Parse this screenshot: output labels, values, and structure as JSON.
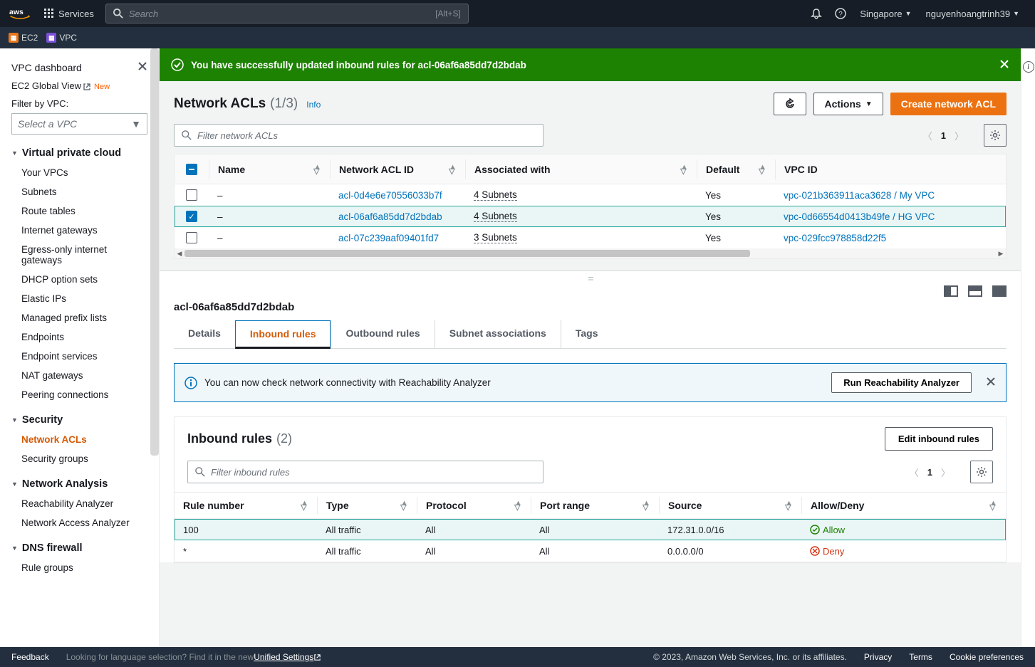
{
  "top_nav": {
    "services": "Services",
    "search_placeholder": "Search",
    "search_kbd": "[Alt+S]",
    "region": "Singapore",
    "account": "nguyenhoangtrinh39"
  },
  "sub_nav": {
    "ec2": "EC2",
    "vpc": "VPC"
  },
  "sidebar": {
    "dashboard": "VPC dashboard",
    "ec2_global": "EC2 Global View",
    "new_badge": "New",
    "filter_label": "Filter by VPC:",
    "filter_placeholder": "Select a VPC",
    "sections": {
      "vpc": {
        "title": "Virtual private cloud",
        "items": [
          "Your VPCs",
          "Subnets",
          "Route tables",
          "Internet gateways",
          "Egress-only internet gateways",
          "DHCP option sets",
          "Elastic IPs",
          "Managed prefix lists",
          "Endpoints",
          "Endpoint services",
          "NAT gateways",
          "Peering connections"
        ]
      },
      "security": {
        "title": "Security",
        "items": [
          "Network ACLs",
          "Security groups"
        ]
      },
      "na": {
        "title": "Network Analysis",
        "items": [
          "Reachability Analyzer",
          "Network Access Analyzer"
        ]
      },
      "dns": {
        "title": "DNS firewall",
        "items": [
          "Rule groups"
        ]
      }
    }
  },
  "banner": {
    "msg": "You have successfully updated inbound rules for acl-06af6a85dd7d2bdab"
  },
  "header": {
    "title": "Network ACLs",
    "count": "(1/3)",
    "info": "Info",
    "actions": "Actions",
    "create": "Create network ACL"
  },
  "filter": {
    "placeholder": "Filter network ACLs"
  },
  "pager": {
    "page": "1"
  },
  "table": {
    "cols": {
      "name": "Name",
      "id": "Network ACL ID",
      "assoc": "Associated with",
      "default": "Default",
      "vpc": "VPC ID"
    },
    "rows": [
      {
        "name": "–",
        "id": "acl-0d4e6e70556033b7f",
        "assoc": "4 Subnets",
        "default": "Yes",
        "vpc": "vpc-021b363911aca3628 / My VPC",
        "selected": false
      },
      {
        "name": "–",
        "id": "acl-06af6a85dd7d2bdab",
        "assoc": "4 Subnets",
        "default": "Yes",
        "vpc": "vpc-0d66554d0413b49fe / HG VPC",
        "selected": true
      },
      {
        "name": "–",
        "id": "acl-07c239aaf09401fd7",
        "assoc": "3 Subnets",
        "default": "Yes",
        "vpc": "vpc-029fcc978858d22f5",
        "selected": false
      }
    ]
  },
  "detail": {
    "title": "acl-06af6a85dd7d2bdab",
    "tabs": [
      "Details",
      "Inbound rules",
      "Outbound rules",
      "Subnet associations",
      "Tags"
    ],
    "info_msg": "You can now check network connectivity with Reachability Analyzer",
    "run_btn": "Run Reachability Analyzer",
    "panel": {
      "title": "Inbound rules",
      "count": "(2)",
      "edit_btn": "Edit inbound rules",
      "filter_placeholder": "Filter inbound rules",
      "page": "1",
      "cols": {
        "num": "Rule number",
        "type": "Type",
        "proto": "Protocol",
        "port": "Port range",
        "src": "Source",
        "ad": "Allow/Deny"
      },
      "rows": [
        {
          "num": "100",
          "type": "All traffic",
          "proto": "All",
          "port": "All",
          "src": "172.31.0.0/16",
          "ad": "Allow"
        },
        {
          "num": "*",
          "type": "All traffic",
          "proto": "All",
          "port": "All",
          "src": "0.0.0.0/0",
          "ad": "Deny"
        }
      ]
    }
  },
  "footer": {
    "feedback": "Feedback",
    "lang_q": "Looking for language selection? Find it in the new ",
    "lang_link": "Unified Settings",
    "copyright": "© 2023, Amazon Web Services, Inc. or its affiliates.",
    "privacy": "Privacy",
    "terms": "Terms",
    "cookies": "Cookie preferences"
  }
}
